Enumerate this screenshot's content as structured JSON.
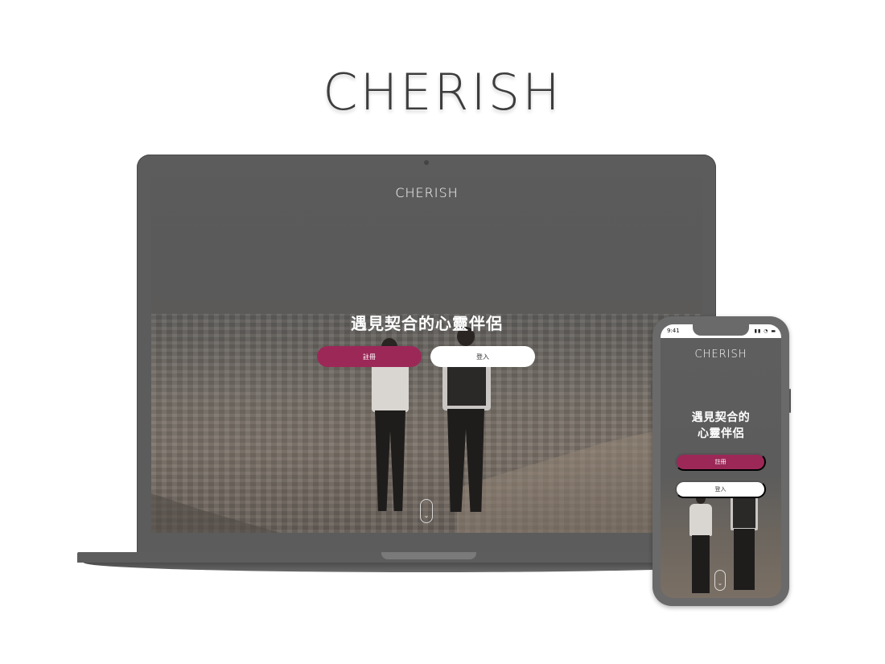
{
  "brand": {
    "logo_text": "CHERISH"
  },
  "desktop": {
    "logo_text": "CHERISH",
    "hero_title": "遇見契合的心靈伴侶",
    "register_label": "註冊",
    "login_label": "登入",
    "scroll_icon": "chevron-down-icon"
  },
  "mobile": {
    "status_time": "9:41",
    "logo_text": "CHERISH",
    "hero_title_line1": "遇見契合的",
    "hero_title_line2": "心靈伴侶",
    "register_label": "註冊",
    "login_label": "登入",
    "scroll_icon": "chevron-down-icon"
  },
  "colors": {
    "accent": "#9c2858",
    "device": "#5c5c5c",
    "overlay": "#5a5a5a",
    "button_light": "#ffffff"
  }
}
